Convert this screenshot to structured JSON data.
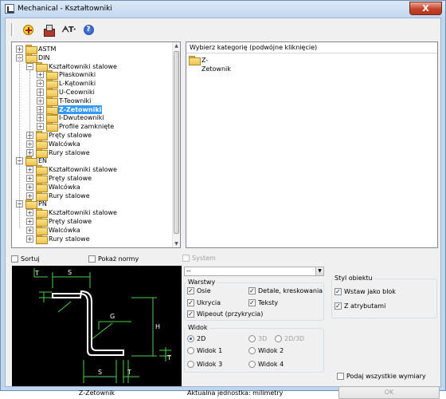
{
  "window": {
    "title": "Mechanical - Kształtowniki",
    "close_glyph": "X"
  },
  "toolbar": {
    "buttons": [
      {
        "name": "add-icon"
      },
      {
        "name": "properties-icon"
      },
      {
        "name": "text-icon",
        "glyph": "ᗅT·"
      },
      {
        "name": "help-icon",
        "glyph": "?"
      }
    ]
  },
  "tree": {
    "items": [
      {
        "label": "ASTM",
        "level": 0,
        "expander": "+"
      },
      {
        "label": "DIN",
        "level": 0,
        "expander": "−"
      },
      {
        "label": "Kształtowniki stalowe",
        "level": 1,
        "expander": "−"
      },
      {
        "label": "Płaskowniki",
        "level": 2,
        "expander": "+"
      },
      {
        "label": "L-Kątowniki",
        "level": 2,
        "expander": "+"
      },
      {
        "label": "U-Ceowniki",
        "level": 2,
        "expander": "+"
      },
      {
        "label": "T-Teowniki",
        "level": 2,
        "expander": "+"
      },
      {
        "label": "Z-Zetowniki",
        "level": 2,
        "expander": "+",
        "selected": true
      },
      {
        "label": "I-Dwuteowniki",
        "level": 2,
        "expander": "+"
      },
      {
        "label": "Profile zamknięte",
        "level": 2,
        "expander": "+"
      },
      {
        "label": "Pręty stalowe",
        "level": 1,
        "expander": "+"
      },
      {
        "label": "Walcówka",
        "level": 1,
        "expander": "+"
      },
      {
        "label": "Rury stalowe",
        "level": 1,
        "expander": "+"
      },
      {
        "label": "EN",
        "level": 0,
        "expander": "−"
      },
      {
        "label": "Kształtowniki stalowe",
        "level": 1,
        "expander": "+"
      },
      {
        "label": "Pręty stalowe",
        "level": 1,
        "expander": "+"
      },
      {
        "label": "Walcówka",
        "level": 1,
        "expander": "+"
      },
      {
        "label": "Rury stalowe",
        "level": 1,
        "expander": "+"
      },
      {
        "label": "PN",
        "level": 0,
        "expander": "−"
      },
      {
        "label": "Kształtowniki stalowe",
        "level": 1,
        "expander": "+"
      },
      {
        "label": "Pręty stalowe",
        "level": 1,
        "expander": "+"
      },
      {
        "label": "Walcówka",
        "level": 1,
        "expander": "+"
      },
      {
        "label": "Rury stalowe",
        "level": 1,
        "expander": "+"
      }
    ]
  },
  "category_panel": {
    "header": "Wybierz kategorię (podwójne kliknięcie)",
    "items": [
      "Z-Zetownik"
    ]
  },
  "options": {
    "sortuj": {
      "label": "Sortuj",
      "checked": false
    },
    "pokaz_normy": {
      "label": "Pokaż normy",
      "checked": false
    },
    "system": {
      "label": "System",
      "checked": false
    }
  },
  "combo": {
    "value": "--"
  },
  "preview": {
    "caption": "Z-Zetownik",
    "dim_labels": {
      "t_top": "T",
      "s_top": "S",
      "g": "G",
      "h": "H",
      "t_right": "T",
      "s_bottom": "S",
      "t_bottom": "T"
    }
  },
  "warstwy": {
    "title": "Warstwy",
    "items": [
      {
        "label": "Osie",
        "checked": true
      },
      {
        "label": "Detale, kreskowania",
        "checked": true
      },
      {
        "label": "Ukrycia",
        "checked": true
      },
      {
        "label": "Teksty",
        "checked": true
      },
      {
        "label": "Wipeout (przykrycia)",
        "checked": true
      }
    ]
  },
  "widok": {
    "title": "Widok",
    "items": [
      {
        "label": "2D",
        "selected": true,
        "disabled": false
      },
      {
        "label": "3D",
        "selected": false,
        "disabled": true
      },
      {
        "label": "2D/3D",
        "selected": false,
        "disabled": true
      },
      {
        "label": "Widok 1",
        "selected": false,
        "disabled": false
      },
      {
        "label": "Widok 2",
        "selected": false,
        "disabled": false
      },
      {
        "label": "Widok 3",
        "selected": false,
        "disabled": false
      },
      {
        "label": "Widok 4",
        "selected": false,
        "disabled": false
      }
    ]
  },
  "styl_obiektu": {
    "title": "Styl obiektu",
    "items": [
      {
        "label": "Wstaw jako blok",
        "checked": true
      },
      {
        "label": "Z atrybutami",
        "checked": true
      }
    ]
  },
  "footer": {
    "all_dims": {
      "label": "Podaj wszystkie wymiary",
      "checked": false
    },
    "unit_text": "Aktualna jednostka: milimetry",
    "ok_label": "OK"
  },
  "colors": {
    "selection": "#3399ff",
    "preview_bg": "#000000",
    "dim_lines": "#4cd04c",
    "profile": "#ffffff"
  }
}
